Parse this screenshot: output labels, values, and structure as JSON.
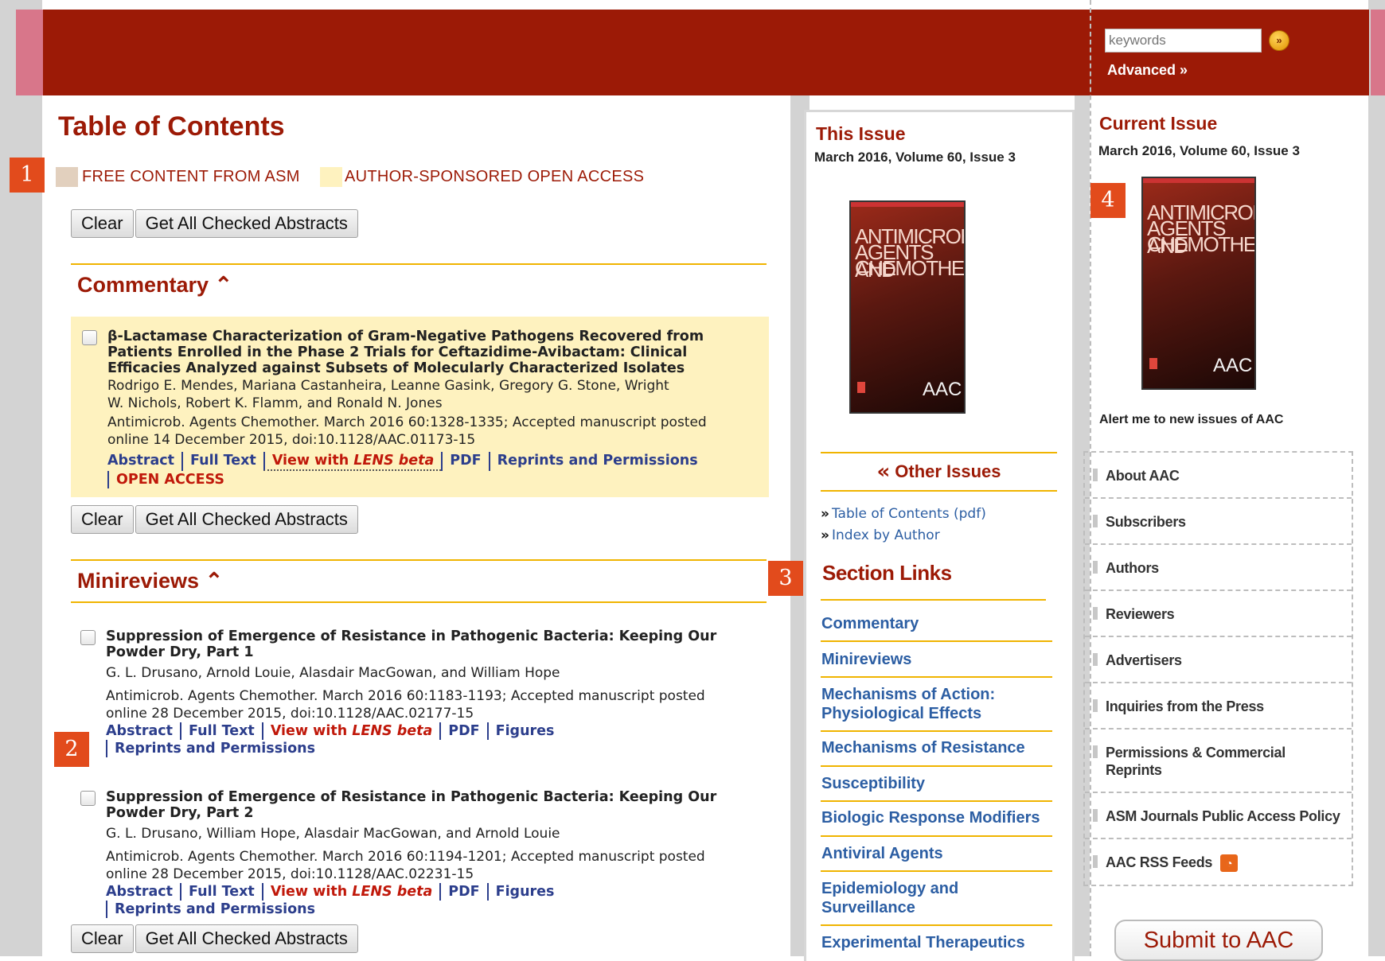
{
  "header": {
    "search_placeholder": "keywords",
    "search_go": "»",
    "advanced_label": "Advanced »"
  },
  "toc": {
    "title": "Table of Contents",
    "legend_free": "FREE CONTENT FROM ASM",
    "legend_open": "AUTHOR-SPONSORED OPEN ACCESS",
    "clear_label": "Clear",
    "get_all_label": "Get All Checked Abstracts"
  },
  "sections": {
    "commentary": "Commentary ⌃",
    "minireviews": "Minireviews ⌃"
  },
  "articles": [
    {
      "title": "β-Lactamase Characterization of Gram-Negative Pathogens Recovered from Patients Enrolled in the Phase 2 Trials for Ceftazidime-Avibactam: Clinical Efficacies Analyzed against Subsets of Molecularly Characterized Isolates",
      "authors": "Rodrigo E. Mendes, Mariana Castanheira, Leanne Gasink, Gregory G. Stone, Wright W. Nichols, Robert K. Flamm, and Ronald N. Jones",
      "citation": "Antimicrob. Agents Chemother.  March 2016 60:1328-1335; Accepted manuscript posted online 14 December 2015, doi:10.1128/AAC.01173-15",
      "links": {
        "abstract": "Abstract",
        "full_text": "Full Text",
        "view_with": "View with ",
        "lens": "LENS beta",
        "pdf": "PDF",
        "reprints": "Reprints and Permissions",
        "open_access": "OPEN ACCESS"
      }
    },
    {
      "title": "Suppression of Emergence of Resistance in Pathogenic Bacteria: Keeping Our Powder Dry, Part 1",
      "authors": "G. L. Drusano, Arnold Louie, Alasdair MacGowan, and William Hope",
      "citation": "Antimicrob. Agents Chemother.  March 2016 60:1183-1193; Accepted manuscript posted online 28 December 2015, doi:10.1128/AAC.02177-15",
      "links": {
        "abstract": "Abstract",
        "full_text": "Full Text",
        "view_with": "View with ",
        "lens": "LENS beta",
        "pdf": "PDF",
        "figures": "Figures",
        "reprints": "Reprints and Permissions"
      }
    },
    {
      "title": "Suppression of Emergence of Resistance in Pathogenic Bacteria: Keeping Our Powder Dry, Part 2",
      "authors": "G. L. Drusano, William Hope, Alasdair MacGowan, and Arnold Louie",
      "citation": "Antimicrob. Agents Chemother.  March 2016 60:1194-1201; Accepted manuscript posted online 28 December 2015, doi:10.1128/AAC.02231-15",
      "links": {
        "abstract": "Abstract",
        "full_text": "Full Text",
        "view_with": "View with ",
        "lens": "LENS beta",
        "pdf": "PDF",
        "figures": "Figures",
        "reprints": "Reprints and Permissions"
      }
    }
  ],
  "callouts": [
    "1",
    "2",
    "3",
    "4"
  ],
  "this_issue": {
    "title": "This Issue",
    "meta": "March 2016, Volume 60, Issue 3",
    "other_issues": "Other Issues",
    "toc_pdf": "Table of Contents (pdf)",
    "index_by_author": "Index by Author",
    "section_links_title": "Section Links",
    "section_links": [
      "Commentary",
      "Minireviews",
      "Mechanisms of Action: Physiological Effects",
      "Mechanisms of Resistance",
      "Susceptibility",
      "Biologic Response Modifiers",
      "Antiviral Agents",
      "Epidemiology and Surveillance",
      "Experimental Therapeutics"
    ]
  },
  "cover": {
    "title_lines": [
      "ANTIMICROBIAL",
      "AGENTS AND",
      "CHEMOTHERAPY"
    ],
    "logo": "AAC"
  },
  "current_issue": {
    "title": "Current Issue",
    "meta": "March 2016, Volume 60, Issue 3",
    "alert": "Alert me to new issues of AAC"
  },
  "right_nav": [
    "About AAC",
    "Subscribers",
    "Authors",
    "Reviewers",
    "Advertisers",
    "Inquiries from the Press",
    "Permissions & Commercial Reprints",
    "ASM Journals Public Access Policy",
    "AAC RSS Feeds"
  ],
  "submit_label": "Submit to AAC",
  "colors": {
    "brand_red": "#9c1a06",
    "accent_gold": "#f0b400",
    "link_blue": "#2c3e8c",
    "open_access_yellow": "#fef2bf",
    "free_beige": "#e2d0be",
    "callout_orange": "#e24b1c"
  }
}
